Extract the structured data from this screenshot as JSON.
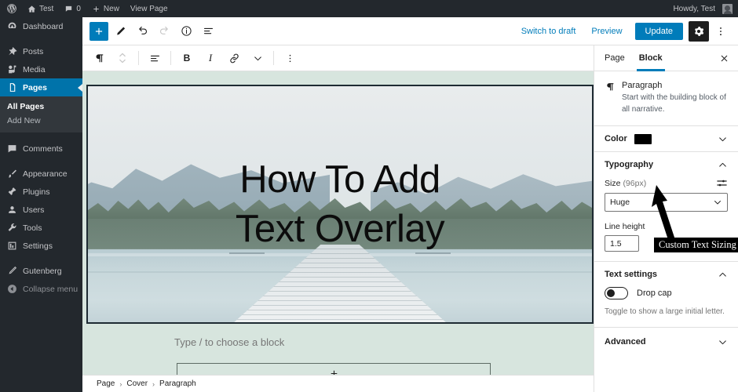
{
  "adminbar": {
    "logo_icon": "wordpress-logo-icon",
    "site_name": "Test",
    "comments_icon": "comment-bubble-icon",
    "comments_count": "0",
    "new_icon": "plus-icon",
    "new_label": "New",
    "view_page_label": "View Page",
    "howdy": "Howdy, Test",
    "avatar_icon": "user-avatar-icon"
  },
  "sidebar": {
    "items": [
      {
        "label": "Dashboard",
        "icon": "dashboard-icon",
        "current": false
      },
      {
        "label": "Posts",
        "icon": "pin-icon",
        "current": false
      },
      {
        "label": "Media",
        "icon": "media-icon",
        "current": false
      },
      {
        "label": "Pages",
        "icon": "pages-icon",
        "current": true
      },
      {
        "label": "Comments",
        "icon": "comment-bubble-icon",
        "current": false
      },
      {
        "label": "Appearance",
        "icon": "brush-icon",
        "current": false
      },
      {
        "label": "Plugins",
        "icon": "plugin-icon",
        "current": false
      },
      {
        "label": "Users",
        "icon": "user-icon",
        "current": false
      },
      {
        "label": "Tools",
        "icon": "wrench-icon",
        "current": false
      },
      {
        "label": "Settings",
        "icon": "settings-sliders-icon",
        "current": false
      },
      {
        "label": "Gutenberg",
        "icon": "pencil-icon",
        "current": false
      },
      {
        "label": "Collapse menu",
        "icon": "collapse-arrow-icon",
        "current": false
      }
    ],
    "submenu": [
      {
        "label": "All Pages",
        "current": true
      },
      {
        "label": "Add New",
        "current": false
      }
    ]
  },
  "header": {
    "add_block_icon": "plus-icon",
    "edit_icon": "pencil-icon",
    "undo_icon": "undo-icon",
    "redo_icon": "redo-icon",
    "info_icon": "info-circle-icon",
    "list_view_icon": "list-view-icon",
    "switch_to_draft_label": "Switch to draft",
    "preview_label": "Preview",
    "update_label": "Update",
    "settings_gear_icon": "gear-icon",
    "more_options_icon": "kebab-menu-icon"
  },
  "block_toolbar": {
    "block_type_icon": "paragraph-icon",
    "movers_icon": "up-down-chevrons-icon",
    "align_icon": "align-text-icon",
    "bold_label": "B",
    "italic_label": "I",
    "link_icon": "link-icon",
    "more_rich_text_icon": "chevron-down-icon",
    "options_icon": "kebab-menu-icon"
  },
  "canvas": {
    "cover_heading_line1": "How To Add",
    "cover_heading_line2": "Text Overlay",
    "cover_font_size_px": "96px",
    "empty_paragraph_placeholder": "Type / to choose a block",
    "appender_icon": "plus-icon",
    "background_color": "#d7e5de"
  },
  "breadcrumb": {
    "items": [
      "Page",
      "Cover",
      "Paragraph"
    ],
    "separator": "›"
  },
  "settings_sidebar": {
    "tabs": [
      {
        "label": "Page",
        "active": false
      },
      {
        "label": "Block",
        "active": true
      }
    ],
    "close_icon": "close-icon",
    "block_card": {
      "icon": "paragraph-icon",
      "title": "Paragraph",
      "description": "Start with the building block of all narrative."
    },
    "color_panel": {
      "title": "Color",
      "swatch_color": "#000000",
      "chevron_icon": "chevron-down-icon"
    },
    "typography_panel": {
      "title": "Typography",
      "chevron_icon": "chevron-up-icon",
      "size_label": "Size",
      "size_value": "(96px)",
      "size_settings_icon": "sliders-icon",
      "size_select_value": "Huge",
      "size_select_chevron_icon": "chevron-down-icon",
      "line_height_label": "Line height",
      "line_height_value": "1.5"
    },
    "text_settings_panel": {
      "title": "Text settings",
      "chevron_icon": "chevron-up-icon",
      "drop_cap_label": "Drop cap",
      "drop_cap_enabled": false,
      "help_text": "Toggle to show a large initial letter."
    },
    "advanced_panel": {
      "title": "Advanced",
      "chevron_icon": "chevron-down-icon"
    }
  },
  "annotation": {
    "label": "Custom Text Sizing",
    "arrow_icon": "arrow-up-pointer-icon"
  },
  "colors": {
    "admin_dark": "#23282d",
    "admin_highlight": "#0073aa",
    "accent_blue": "#007cba",
    "canvas_green": "#d7e5de"
  }
}
